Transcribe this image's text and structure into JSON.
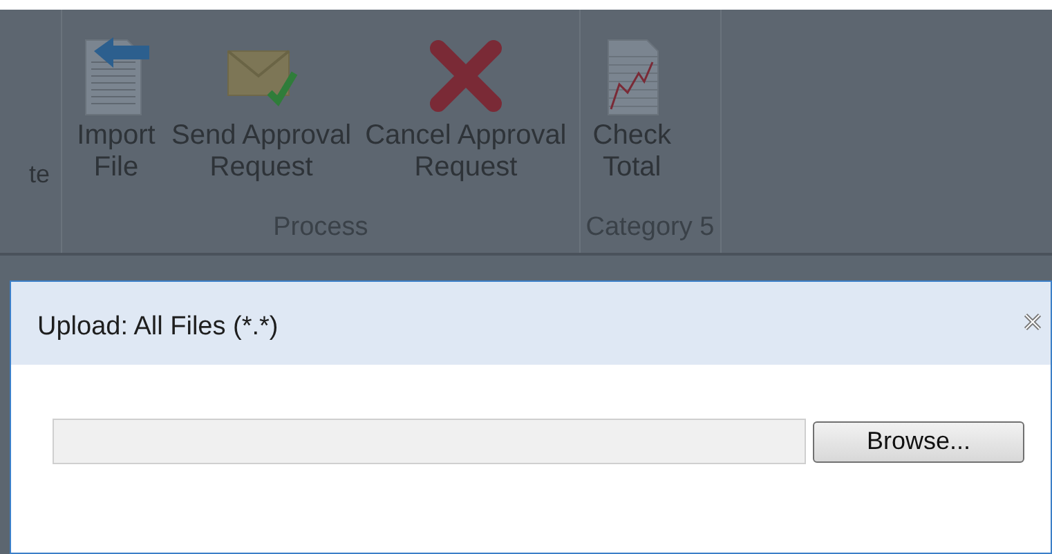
{
  "ribbon": {
    "cut_label": "te",
    "groups": [
      {
        "label": "Process",
        "buttons": [
          {
            "kind": "import",
            "label_lines": [
              "Import",
              "File"
            ]
          },
          {
            "kind": "send",
            "label_lines": [
              "Send Approval",
              "Request"
            ]
          },
          {
            "kind": "cancel",
            "label_lines": [
              "Cancel Approval",
              "Request"
            ]
          }
        ]
      },
      {
        "label": "Category 5",
        "buttons": [
          {
            "kind": "chart",
            "label_lines": [
              "Check",
              "Total"
            ]
          }
        ]
      }
    ]
  },
  "dialog": {
    "title": "Upload: All Files (*.*)",
    "browse_button": "Browse..."
  }
}
